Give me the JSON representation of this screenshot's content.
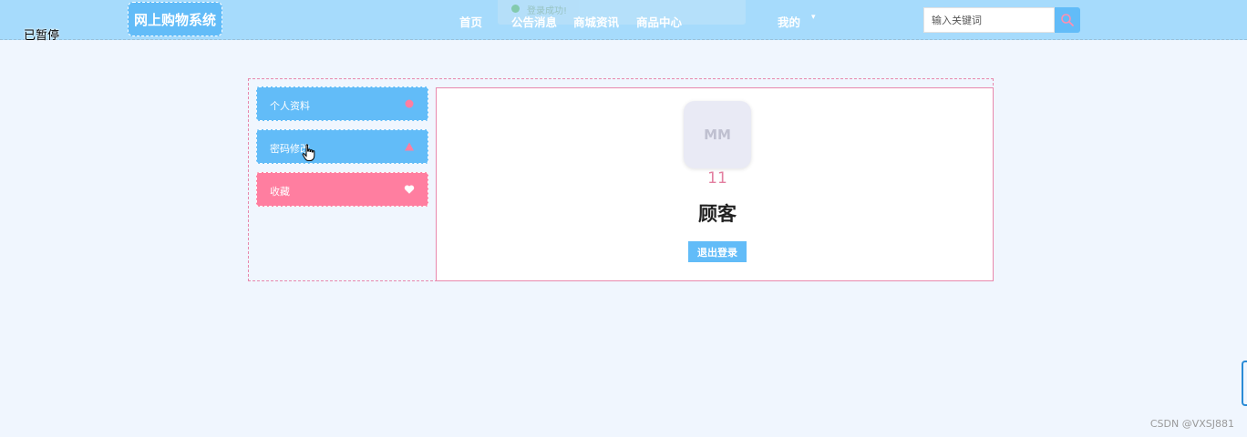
{
  "overlay": {
    "paused": "已暂停"
  },
  "header": {
    "logo": "网上购物系统",
    "toast": "登录成功!",
    "nav": [
      "首页",
      "公告消息",
      "商城资讯",
      "商品中心"
    ],
    "mine": "我的",
    "search_placeholder": "输入关键词"
  },
  "sidebar": {
    "items": [
      {
        "label": "个人资料",
        "icon": "dot-icon"
      },
      {
        "label": "密码修改",
        "icon": "triangle-icon"
      },
      {
        "label": "收藏",
        "icon": "heart-icon"
      }
    ]
  },
  "profile": {
    "avatar_text": "MM",
    "user_id": "11",
    "role": "顾客",
    "logout_label": "退出登录"
  },
  "watermark": "CSDN @VXSJ881",
  "colors": {
    "header_bg": "#a6dbfc",
    "primary": "#62bcf8",
    "accent_pink": "#ff7ea0",
    "page_bg": "#f0f6fe"
  }
}
